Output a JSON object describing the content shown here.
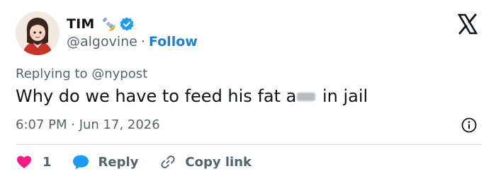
{
  "author": {
    "name": "TIM",
    "handle": "@algovine",
    "separator": "·",
    "follow_label": "Follow",
    "name_emoji": "satellite-emoji",
    "badge": "verified-badge"
  },
  "tweet": {
    "replying_prefix": "Replying to ",
    "replying_to": "@nypost",
    "text_before": "Why do we have to feed his fat a",
    "text_after": " in jail",
    "time": "6:07 PM",
    "time_separator": " · ",
    "date": "Jun 17, 2026"
  },
  "actions": {
    "like_count": "1",
    "reply_label": "Reply",
    "copy_label": "Copy link"
  },
  "colors": {
    "accent": "#1d7ed8",
    "like": "#f91880",
    "reply": "#1d9bf0",
    "muted": "#536471",
    "text": "#0f1419"
  }
}
